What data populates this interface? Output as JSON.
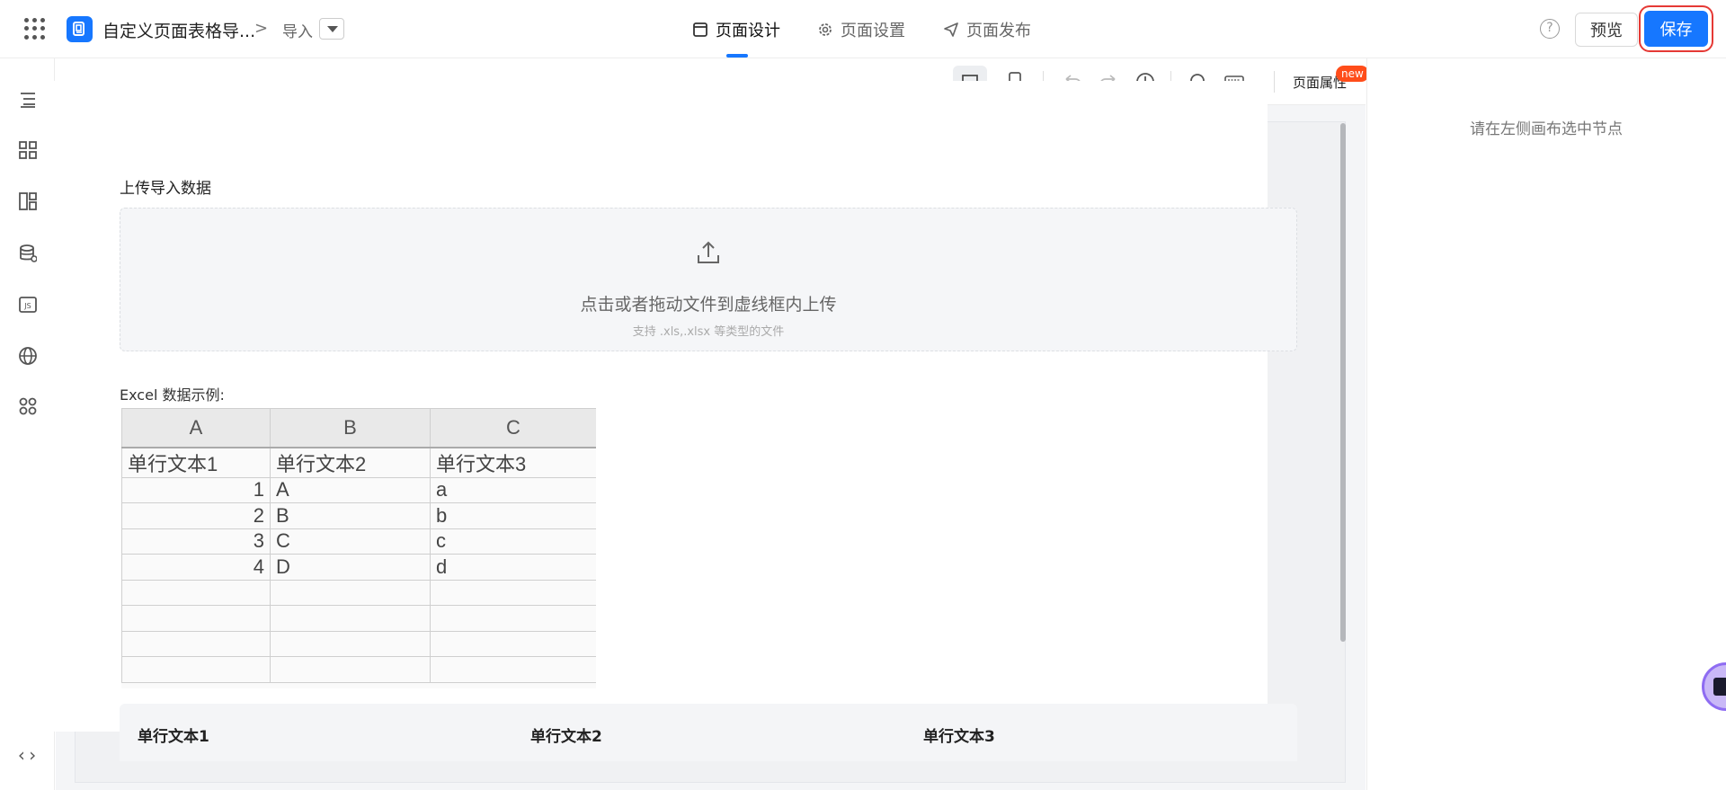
{
  "header": {
    "app_name": "自定义页面表格导...",
    "breadcrumb_sep": ">",
    "page_name": "导入",
    "tabs": [
      {
        "label": "页面设计",
        "icon": "layout-icon",
        "active": true
      },
      {
        "label": "页面设置",
        "icon": "gear-icon",
        "active": false
      },
      {
        "label": "页面发布",
        "icon": "send-icon",
        "active": false
      }
    ],
    "help": "?",
    "preview_label": "预览",
    "save_label": "保存"
  },
  "toolbar": {
    "page_props_label": "页面属性",
    "new_badge": "new"
  },
  "upload": {
    "label": "上传导入数据",
    "main_text": "点击或者拖动文件到虚线框内上传",
    "sub_text": "支持 .xls,.xlsx 等类型的文件"
  },
  "excel_example": {
    "label": "Excel 数据示例:",
    "col_letters": [
      "A",
      "B",
      "C"
    ],
    "header_row": [
      "单行文本1",
      "单行文本2",
      "单行文本3"
    ],
    "rows": [
      [
        "1",
        "A",
        "a"
      ],
      [
        "2",
        "B",
        "b"
      ],
      [
        "3",
        "C",
        "c"
      ],
      [
        "4",
        "D",
        "d"
      ]
    ]
  },
  "table": {
    "columns": [
      "单行文本1",
      "单行文本2",
      "单行文本3"
    ]
  },
  "right_panel": {
    "hint": "请在左侧画布选中节点"
  },
  "colors": {
    "primary": "#1677ff",
    "highlight_border": "#e53935",
    "badge": "#ff4d1a",
    "online": "#20c05c"
  }
}
